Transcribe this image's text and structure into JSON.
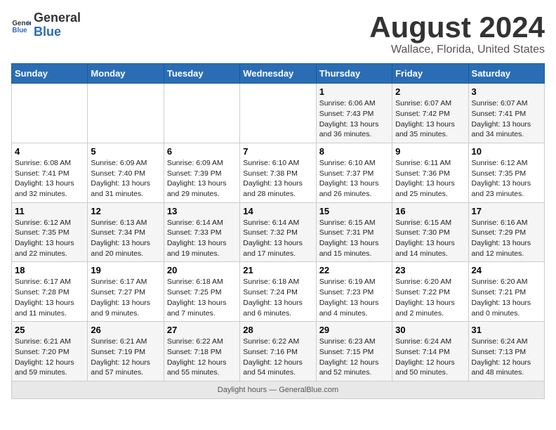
{
  "header": {
    "logo_general": "General",
    "logo_blue": "Blue",
    "title": "August 2024",
    "subtitle": "Wallace, Florida, United States"
  },
  "days_of_week": [
    "Sunday",
    "Monday",
    "Tuesday",
    "Wednesday",
    "Thursday",
    "Friday",
    "Saturday"
  ],
  "weeks": [
    [
      {
        "day": "",
        "info": ""
      },
      {
        "day": "",
        "info": ""
      },
      {
        "day": "",
        "info": ""
      },
      {
        "day": "",
        "info": ""
      },
      {
        "day": "1",
        "info": "Sunrise: 6:06 AM\nSunset: 7:43 PM\nDaylight: 13 hours and 36 minutes."
      },
      {
        "day": "2",
        "info": "Sunrise: 6:07 AM\nSunset: 7:42 PM\nDaylight: 13 hours and 35 minutes."
      },
      {
        "day": "3",
        "info": "Sunrise: 6:07 AM\nSunset: 7:41 PM\nDaylight: 13 hours and 34 minutes."
      }
    ],
    [
      {
        "day": "4",
        "info": "Sunrise: 6:08 AM\nSunset: 7:41 PM\nDaylight: 13 hours and 32 minutes."
      },
      {
        "day": "5",
        "info": "Sunrise: 6:09 AM\nSunset: 7:40 PM\nDaylight: 13 hours and 31 minutes."
      },
      {
        "day": "6",
        "info": "Sunrise: 6:09 AM\nSunset: 7:39 PM\nDaylight: 13 hours and 29 minutes."
      },
      {
        "day": "7",
        "info": "Sunrise: 6:10 AM\nSunset: 7:38 PM\nDaylight: 13 hours and 28 minutes."
      },
      {
        "day": "8",
        "info": "Sunrise: 6:10 AM\nSunset: 7:37 PM\nDaylight: 13 hours and 26 minutes."
      },
      {
        "day": "9",
        "info": "Sunrise: 6:11 AM\nSunset: 7:36 PM\nDaylight: 13 hours and 25 minutes."
      },
      {
        "day": "10",
        "info": "Sunrise: 6:12 AM\nSunset: 7:35 PM\nDaylight: 13 hours and 23 minutes."
      }
    ],
    [
      {
        "day": "11",
        "info": "Sunrise: 6:12 AM\nSunset: 7:35 PM\nDaylight: 13 hours and 22 minutes."
      },
      {
        "day": "12",
        "info": "Sunrise: 6:13 AM\nSunset: 7:34 PM\nDaylight: 13 hours and 20 minutes."
      },
      {
        "day": "13",
        "info": "Sunrise: 6:14 AM\nSunset: 7:33 PM\nDaylight: 13 hours and 19 minutes."
      },
      {
        "day": "14",
        "info": "Sunrise: 6:14 AM\nSunset: 7:32 PM\nDaylight: 13 hours and 17 minutes."
      },
      {
        "day": "15",
        "info": "Sunrise: 6:15 AM\nSunset: 7:31 PM\nDaylight: 13 hours and 15 minutes."
      },
      {
        "day": "16",
        "info": "Sunrise: 6:15 AM\nSunset: 7:30 PM\nDaylight: 13 hours and 14 minutes."
      },
      {
        "day": "17",
        "info": "Sunrise: 6:16 AM\nSunset: 7:29 PM\nDaylight: 13 hours and 12 minutes."
      }
    ],
    [
      {
        "day": "18",
        "info": "Sunrise: 6:17 AM\nSunset: 7:28 PM\nDaylight: 13 hours and 11 minutes."
      },
      {
        "day": "19",
        "info": "Sunrise: 6:17 AM\nSunset: 7:27 PM\nDaylight: 13 hours and 9 minutes."
      },
      {
        "day": "20",
        "info": "Sunrise: 6:18 AM\nSunset: 7:25 PM\nDaylight: 13 hours and 7 minutes."
      },
      {
        "day": "21",
        "info": "Sunrise: 6:18 AM\nSunset: 7:24 PM\nDaylight: 13 hours and 6 minutes."
      },
      {
        "day": "22",
        "info": "Sunrise: 6:19 AM\nSunset: 7:23 PM\nDaylight: 13 hours and 4 minutes."
      },
      {
        "day": "23",
        "info": "Sunrise: 6:20 AM\nSunset: 7:22 PM\nDaylight: 13 hours and 2 minutes."
      },
      {
        "day": "24",
        "info": "Sunrise: 6:20 AM\nSunset: 7:21 PM\nDaylight: 13 hours and 0 minutes."
      }
    ],
    [
      {
        "day": "25",
        "info": "Sunrise: 6:21 AM\nSunset: 7:20 PM\nDaylight: 12 hours and 59 minutes."
      },
      {
        "day": "26",
        "info": "Sunrise: 6:21 AM\nSunset: 7:19 PM\nDaylight: 12 hours and 57 minutes."
      },
      {
        "day": "27",
        "info": "Sunrise: 6:22 AM\nSunset: 7:18 PM\nDaylight: 12 hours and 55 minutes."
      },
      {
        "day": "28",
        "info": "Sunrise: 6:22 AM\nSunset: 7:16 PM\nDaylight: 12 hours and 54 minutes."
      },
      {
        "day": "29",
        "info": "Sunrise: 6:23 AM\nSunset: 7:15 PM\nDaylight: 12 hours and 52 minutes."
      },
      {
        "day": "30",
        "info": "Sunrise: 6:24 AM\nSunset: 7:14 PM\nDaylight: 12 hours and 50 minutes."
      },
      {
        "day": "31",
        "info": "Sunrise: 6:24 AM\nSunset: 7:13 PM\nDaylight: 12 hours and 48 minutes."
      }
    ]
  ],
  "footer": {
    "label": "Daylight hours",
    "source": "GeneralBlue.com"
  }
}
